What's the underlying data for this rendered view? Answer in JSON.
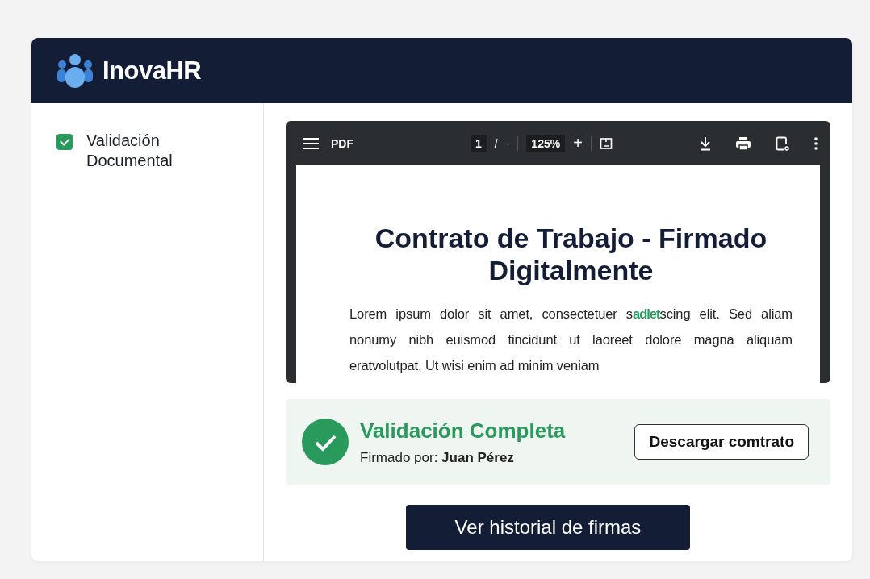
{
  "header": {
    "logo_text": "InovaHR"
  },
  "sidebar": {
    "items": [
      {
        "label": "Validación Documental",
        "checked": true
      }
    ]
  },
  "pdf_viewer": {
    "toolbar": {
      "title": "PDF",
      "page": "1",
      "page_separator": "/",
      "page_total": "-",
      "zoom": "125%",
      "zoom_in": "+"
    },
    "document": {
      "title": "Contrato de Trabajo - Firmado Digitalmente",
      "paragraph": {
        "before": "Lorem ipsum dolor sit amet, consectetuer s",
        "highlight": "adlet",
        "after": "scing elit. Sed aliam nonumy nibh euismod tincidunt ut laoreet dolore magna aliquam eratvolutpat. Ut wisi enim ad minim veniam"
      }
    }
  },
  "validation": {
    "title": "Validación Completa",
    "signed_label": "Firmado por:",
    "signer": "Juan Pérez",
    "download_button": "Descargar comtrato"
  },
  "history_button": "Ver historial de firmas"
}
